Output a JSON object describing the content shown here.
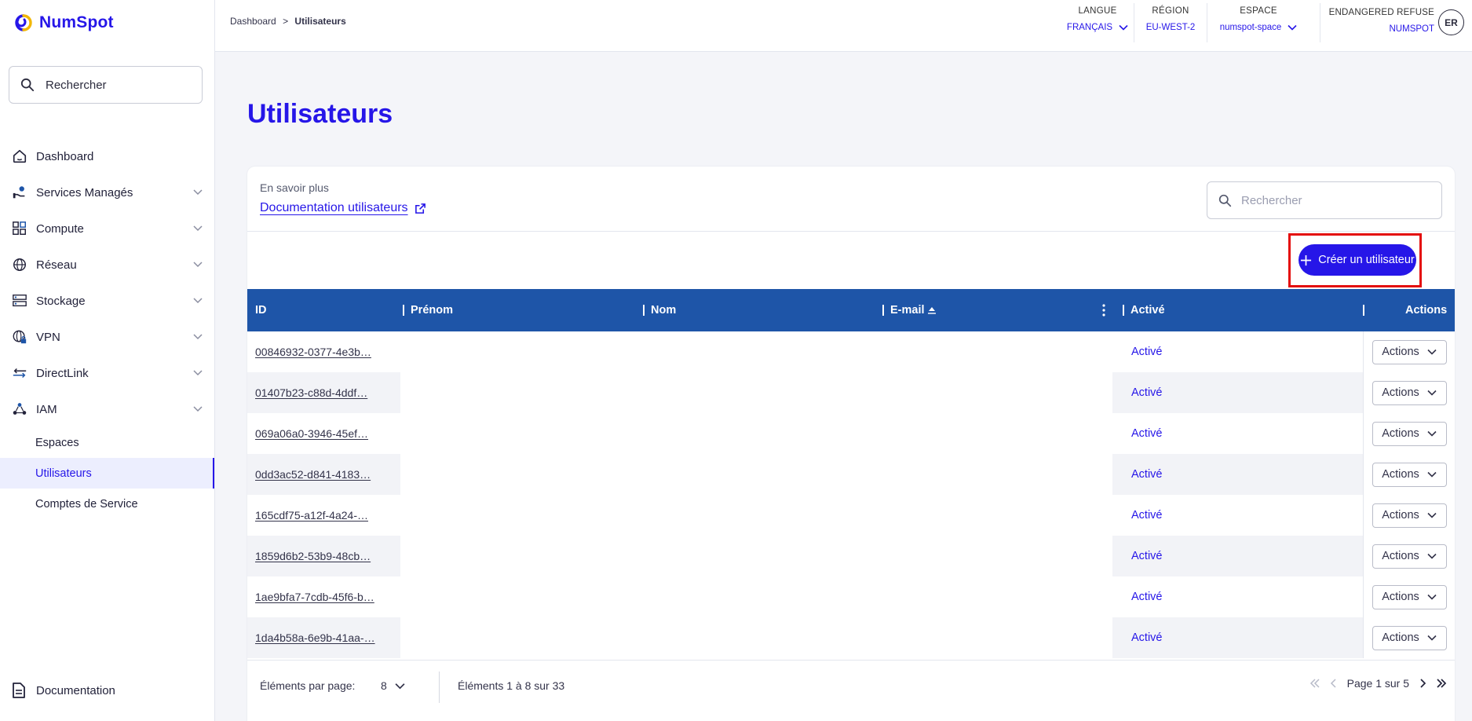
{
  "app": {
    "logo_text": "NumSpot"
  },
  "sidebar": {
    "search_placeholder": "Rechercher",
    "items": [
      {
        "label": "Dashboard",
        "icon": "home-icon"
      },
      {
        "label": "Services Managés",
        "icon": "managed-services-icon"
      },
      {
        "label": "Compute",
        "icon": "compute-icon"
      },
      {
        "label": "Réseau",
        "icon": "network-globe-icon"
      },
      {
        "label": "Stockage",
        "icon": "storage-icon"
      },
      {
        "label": "VPN",
        "icon": "vpn-globe-lock-icon"
      },
      {
        "label": "DirectLink",
        "icon": "directlink-arrows-icon"
      },
      {
        "label": "IAM",
        "icon": "iam-nodes-icon"
      }
    ],
    "iam_sub_items": [
      {
        "label": "Espaces",
        "active": false
      },
      {
        "label": "Utilisateurs",
        "active": true
      },
      {
        "label": "Comptes de Service",
        "active": false
      }
    ],
    "documentation_label": "Documentation"
  },
  "header": {
    "breadcrumb": {
      "parent": "Dashboard",
      "separator": ">",
      "current": "Utilisateurs"
    },
    "language": {
      "label": "LANGUE",
      "value": "FRANÇAIS"
    },
    "region": {
      "label": "RÉGION",
      "value": "EU-WEST-2"
    },
    "space": {
      "label": "ESPACE",
      "value": "numspot-space"
    },
    "user": {
      "line1": "ENDANGERED REFUSE",
      "line2": "NUMSPOT",
      "initials": "ER"
    }
  },
  "main": {
    "title": "Utilisateurs",
    "learn_more": "En savoir plus",
    "doc_link": "Documentation utilisateurs",
    "search_placeholder": "Rechercher",
    "create_button": "Créer un utilisateur"
  },
  "table": {
    "columns": {
      "id": "ID",
      "firstname": "Prénom",
      "lastname": "Nom",
      "email": "E-mail",
      "active": "Activé",
      "actions": "Actions"
    },
    "rows": [
      {
        "id": "00846932-0377-4e3b…",
        "active": "Activé",
        "actions": "Actions"
      },
      {
        "id": "01407b23-c88d-4ddf…",
        "active": "Activé",
        "actions": "Actions"
      },
      {
        "id": "069a06a0-3946-45ef…",
        "active": "Activé",
        "actions": "Actions"
      },
      {
        "id": "0dd3ac52-d841-4183…",
        "active": "Activé",
        "actions": "Actions"
      },
      {
        "id": "165cdf75-a12f-4a24-…",
        "active": "Activé",
        "actions": "Actions"
      },
      {
        "id": "1859d6b2-53b9-48cb…",
        "active": "Activé",
        "actions": "Actions"
      },
      {
        "id": "1ae9bfa7-7cdb-45f6-b…",
        "active": "Activé",
        "actions": "Actions"
      },
      {
        "id": "1da4b58a-6e9b-41aa-…",
        "active": "Activé",
        "actions": "Actions"
      }
    ]
  },
  "footer": {
    "per_page_label": "Éléments par page:",
    "per_page_value": "8",
    "range_text": "Éléments 1 à 8 sur 33",
    "page_text": "Page 1 sur 5"
  },
  "colors": {
    "brand": "#2616e8",
    "table_header": "#1e55a8",
    "highlight": "#e40d0d"
  }
}
